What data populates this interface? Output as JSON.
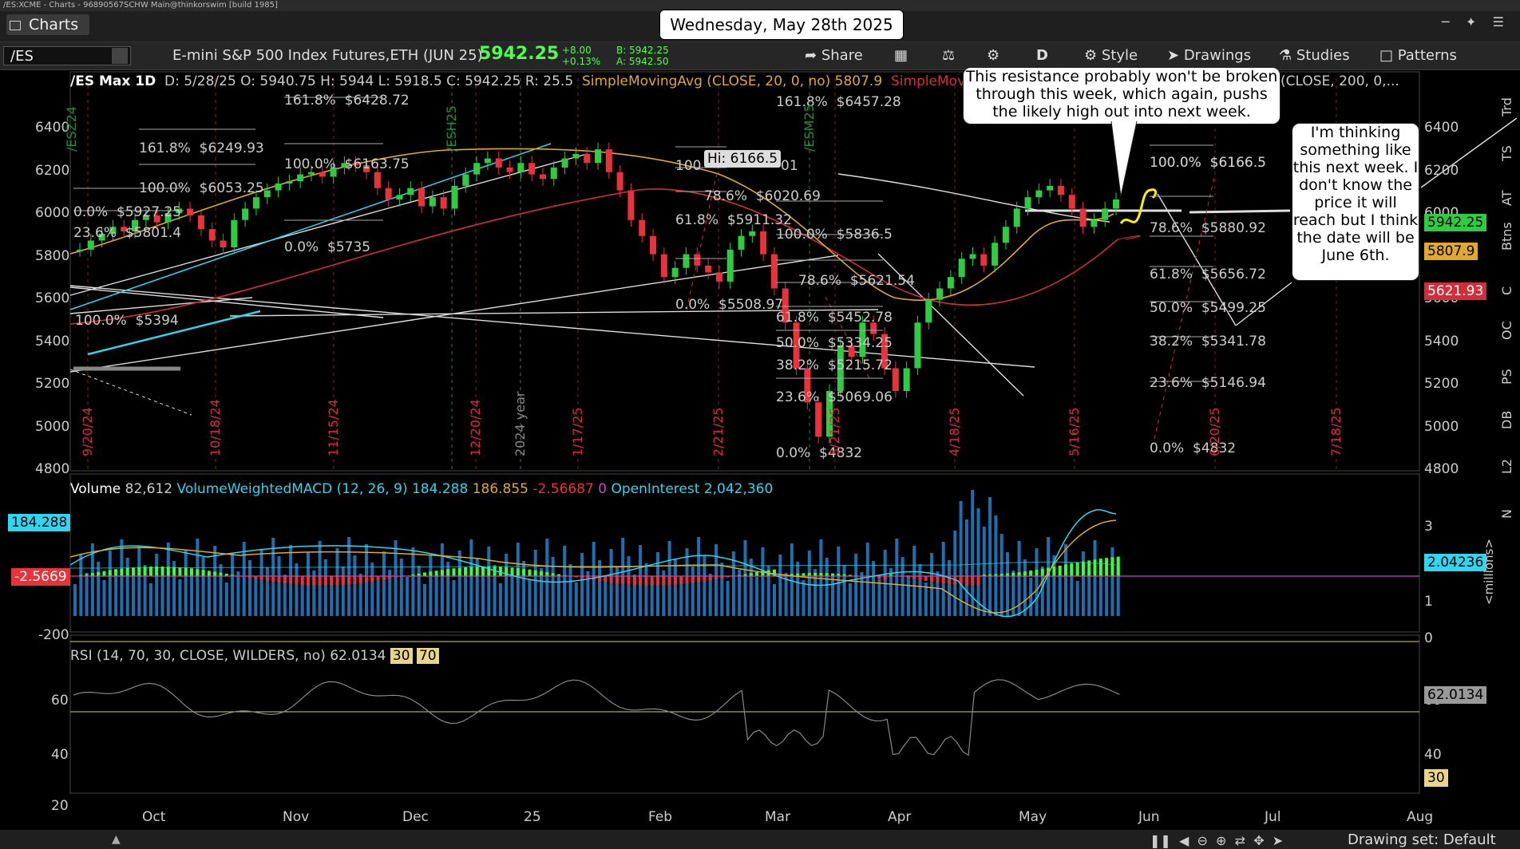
{
  "titlebar": {
    "text": "/ES:XCME - Charts - 96890567SCHW Main@thinkorswim [build 1985]"
  },
  "tabbar": {
    "charts_tab": "Charts",
    "date_label": "Wednesday, May 28th 2025"
  },
  "toolbar": {
    "symbol": "/ES",
    "description": "E-mini S&P 500 Index Futures,ETH (JUN 25)",
    "last": "5942.25",
    "change": "+8.00",
    "change_pct": "+0.13%",
    "bid": "B: 5942.25",
    "ask": "A: 5942.50",
    "share": "Share",
    "timeframe": "D",
    "style": "Style",
    "drawings": "Drawings",
    "studies": "Studies",
    "patterns": "Patterns"
  },
  "header": {
    "name": "/ES Max 1D",
    "ohlc": "D: 5/28/25   O: 5940.75   H: 5944   L: 5918.5   C: 5942.25   R: 25.5",
    "sma1": "SimpleMovingAvg (CLOSE, 20, 0, no)",
    "sma1_val": "5807.9",
    "sma2": "SimpleMovingAvg",
    "sma3": "(CLOSE, 200, 0,..."
  },
  "callouts": {
    "c1": "This resistance probably won't be broken through this week, which again, pushs the likely high out into next week.",
    "c2": "I'm thinking something like this next week. I don't know the price it will reach but I think the date will be June 6th."
  },
  "hi_label": "Hi: 6166.5",
  "fib_labels": [
    "161.8%  $6428.72",
    "100.0%  $6163.75",
    "161.8%  $6249.93",
    "100.0%  $6053.25",
    "0.0%  $5927.25",
    "23.6%  $5801.4",
    "0.0%  $5735",
    "100.0%  $5394",
    "161.8%  $6457.28",
    "100.0%  $6166.5",
    "78.6%  $6020.69",
    "61.8%  $5911.32",
    "100.0%  $5836.5",
    "78.6%  $5621.54",
    "0.0%  $5508.97",
    "61.8%  $5452.78",
    "50.0%  $5334.25",
    "38.2%  $5215.72",
    "23.6%  $5069.06",
    "0.0%  $4832",
    "100.0%  $6166.5",
    "78.6%  $5880.92",
    "61.8%  $5656.72",
    "50.0%  $5499.25",
    "38.2%  $5341.78",
    "23.6%  $5146.94",
    "0.0%  $4832"
  ],
  "fib_extra": {
    "label_a": "100",
    "label_b": "01"
  },
  "price_axis": [
    "6400",
    "6200",
    "6000",
    "5800",
    "5600",
    "5400",
    "5200",
    "5000",
    "4800"
  ],
  "price_tags": {
    "last": "5942.25",
    "sma20": "5807.9",
    "sma50": "5621.93"
  },
  "date_axis": [
    "Oct",
    "Nov",
    "Dec",
    "25",
    "Feb",
    "Mar",
    "Apr",
    "May",
    "Jun",
    "Jul",
    "Aug"
  ],
  "vertical_dates": [
    "9/20/24",
    "10/18/24",
    "11/15/24",
    "12/20/24",
    "2024 year",
    "1/17/25",
    "2/21/25",
    "3/21/25",
    "4/18/25",
    "5/16/25",
    "6/20/25",
    "7/18/25",
    "/ESZ24",
    "/ESH25",
    "/ESM25"
  ],
  "volume": {
    "label": "Volume",
    "val": "82,612",
    "macd": "VolumeWeightedMACD (12, 26, 9)",
    "m1": "184.288",
    "m2": "186.855",
    "m3": "-2.56687",
    "m4": "0",
    "oi": "OpenInterest",
    "oi_val": "2,042,360",
    "left_top": "184.288",
    "left_mid": "-2.5669",
    "left_bot": "-200",
    "right_tag": "2.04236",
    "right_3": "3",
    "right_1": "1",
    "right_0": "0",
    "units": "<millions>"
  },
  "rsi": {
    "label": "RSI (14, 70, 30, CLOSE, WILDERS, no)",
    "val": "62.0134",
    "ob": "30",
    "os": "70",
    "axis": [
      "60",
      "40",
      "20"
    ],
    "tag": "62.0134",
    "tag30": "30"
  },
  "sidebar": [
    "Trd",
    "TS",
    "AT",
    "Btns",
    "C",
    "OC",
    "PS",
    "DB",
    "L2",
    "N"
  ],
  "bottom": {
    "drawing_set": "Drawing set: Default"
  },
  "colors": {
    "up": "#2ecc40",
    "down": "#e8333a",
    "sma20": "#e0a82e",
    "sma50": "#d12e3a",
    "cyan": "#30d5f0"
  }
}
